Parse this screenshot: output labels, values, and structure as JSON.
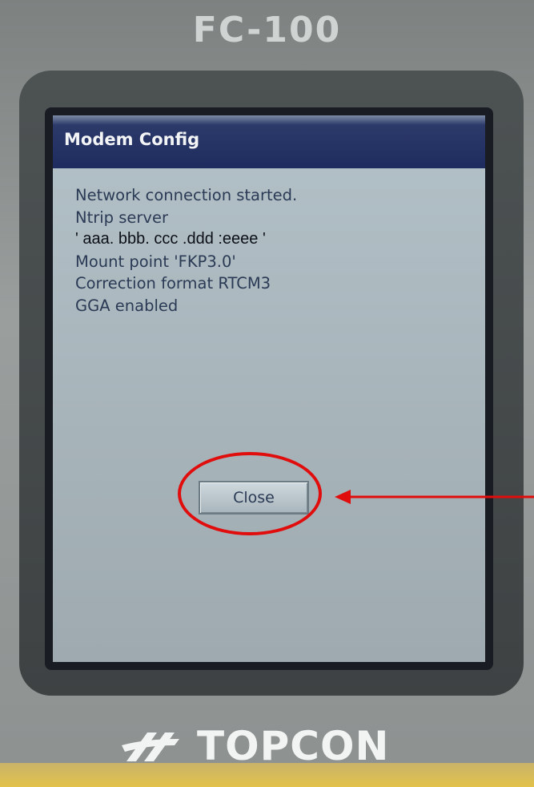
{
  "device": {
    "model": "FC-100",
    "brand": "TOPCON"
  },
  "dialog": {
    "title": "Modem Config",
    "lines": [
      "Network connection started.",
      "Ntrip server",
      "' aaa. bbb. ccc .ddd :eeee '",
      "Mount point 'FKP3.0'",
      "Correction format RTCM3",
      "GGA enabled"
    ],
    "close_label": "Close"
  },
  "annotation": {
    "color": "#e10c0c",
    "shape": "ellipse-with-arrow",
    "target": "close-button"
  },
  "colors": {
    "titlebar": "#1e2b5e",
    "screen_bg": "#a7b4ba",
    "text": "#2b3a55"
  }
}
